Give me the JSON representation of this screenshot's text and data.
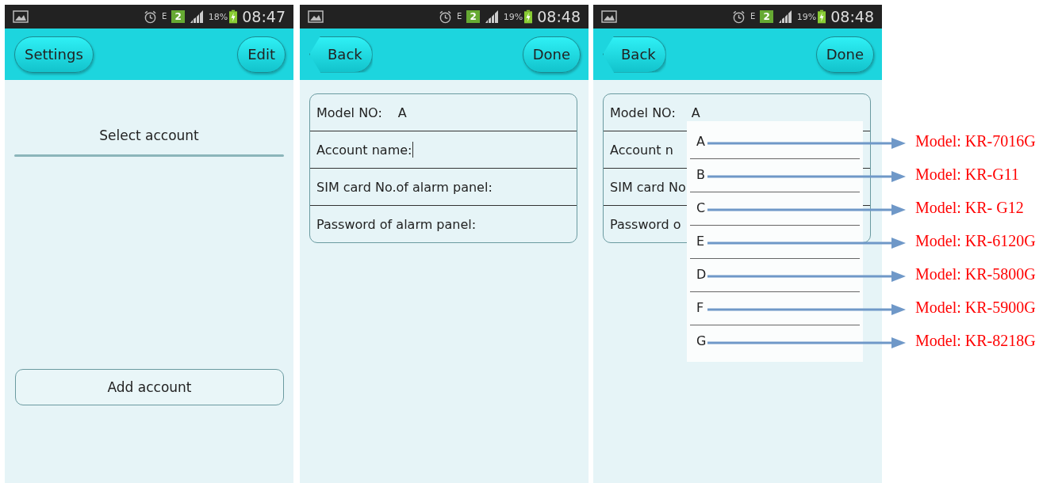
{
  "screens": [
    {
      "kind": "account_list",
      "status_bar": {
        "network": "E",
        "sim": "2",
        "battery": "18%",
        "time": "08:47"
      },
      "toolbar": {
        "left_button": {
          "label": "Settings",
          "kind": "pill"
        },
        "right_button": "Edit"
      },
      "title": "Select account",
      "add_button": "Add account"
    },
    {
      "kind": "form",
      "status_bar": {
        "network": "E",
        "sim": "2",
        "battery": "19%",
        "time": "08:48"
      },
      "toolbar": {
        "left_button": {
          "label": "Back",
          "kind": "back"
        },
        "right_button": "Done"
      },
      "fields": [
        {
          "label": "Model NO:",
          "value": "A",
          "focused": false
        },
        {
          "label": "Account name:",
          "focused": true
        },
        {
          "label": "SIM card No.of alarm panel:",
          "focused": false
        },
        {
          "label": "Password of alarm panel:",
          "focused": false
        }
      ]
    },
    {
      "kind": "form",
      "status_bar": {
        "network": "E",
        "sim": "2",
        "battery": "19%",
        "time": "08:48"
      },
      "toolbar": {
        "left_button": {
          "label": "Back",
          "kind": "back"
        },
        "right_button": "Done"
      },
      "fields": [
        {
          "label": "Model NO:",
          "value": "A"
        },
        {
          "label": "Account n"
        },
        {
          "label": "SIM card No"
        },
        {
          "label": "Password o"
        }
      ],
      "dropdown": {
        "options": [
          {
            "label": "A",
            "annotation": "Model: KR-7016G"
          },
          {
            "label": "B",
            "annotation": "Model: KR-G11"
          },
          {
            "label": "C",
            "annotation": "Model: KR- G12"
          },
          {
            "label": "E",
            "annotation": "Model: KR-6120G"
          },
          {
            "label": "D",
            "annotation": "Model: KR-5800G"
          },
          {
            "label": "F",
            "annotation": "Model: KR-5900G"
          },
          {
            "label": "G",
            "annotation": "Model: KR-8218G"
          }
        ]
      }
    }
  ]
}
